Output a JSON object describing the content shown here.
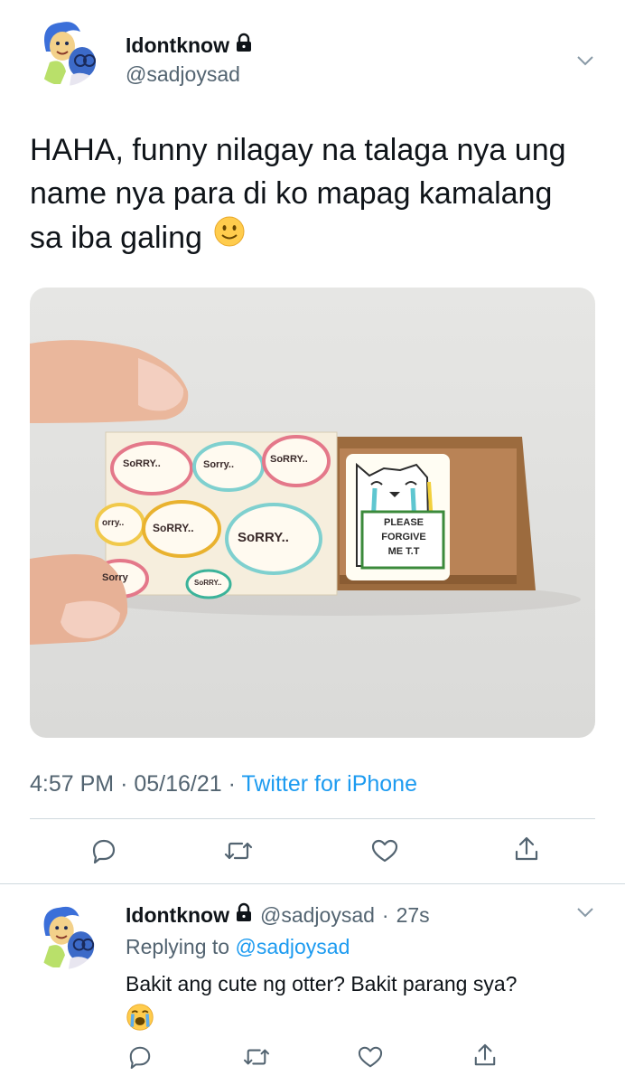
{
  "tweet": {
    "display_name": "Idontknow",
    "handle": "@sadjoysad",
    "text_lines": [
      "HAHA, funny nilagay na talaga nya ung",
      "name nya para di ko mapag kamalang",
      "sa iba galing"
    ],
    "time": "4:57 PM",
    "date": "05/16/21",
    "sep": "·",
    "source": "Twitter for iPhone"
  },
  "image": {
    "bubbles": [
      "SoRRY..",
      "Sorry..",
      "SoRRY..",
      "orry..",
      "SoRRY..",
      "SoRRY..",
      "Sorry",
      "SoRRY.."
    ],
    "sign_lines": [
      "PLEASE",
      "FORGIVE",
      "ME T.T"
    ]
  },
  "reply": {
    "display_name": "Idontknow",
    "handle": "@sadjoysad",
    "sep": "·",
    "age": "27s",
    "replying_label": "Replying to",
    "replying_to": "@sadjoysad",
    "text": "Bakit ang cute ng otter? Bakit parang sya?"
  },
  "icons": [
    "avatar",
    "lock-icon",
    "chevron-down-icon",
    "reply-icon",
    "retweet-icon",
    "like-icon",
    "share-icon",
    "smile-emoji",
    "crying-emoji"
  ],
  "colors": {
    "link": "#1d9bf0",
    "secondary": "#536471",
    "text": "#0f1419",
    "divider": "#cfd9de"
  }
}
